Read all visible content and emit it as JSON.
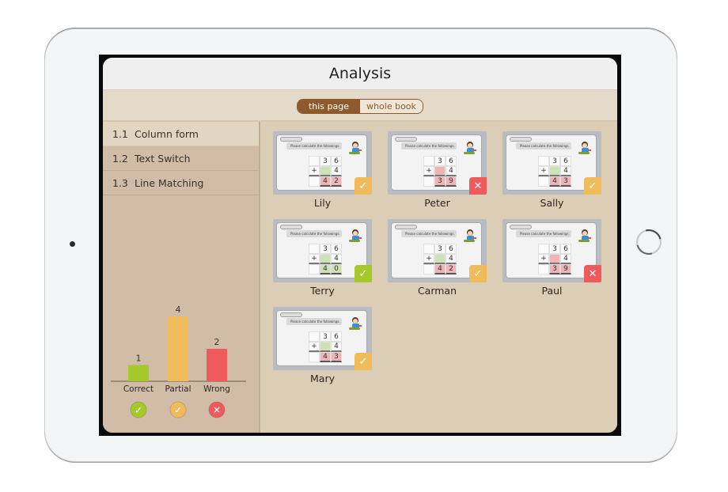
{
  "header": {
    "title": "Analysis"
  },
  "toggle": {
    "options": [
      {
        "label": "this page",
        "active": true
      },
      {
        "label": "whole book",
        "active": false
      }
    ]
  },
  "sidebar": {
    "items": [
      {
        "num": "1.1",
        "label": "Column form",
        "active": true
      },
      {
        "num": "1.2",
        "label": "Text Switch",
        "active": false
      },
      {
        "num": "1.3",
        "label": "Line Matching",
        "active": false
      }
    ]
  },
  "chart_data": {
    "type": "bar",
    "title": "",
    "xlabel": "",
    "ylabel": "",
    "categories": [
      "Correct",
      "Partial",
      "Wrong"
    ],
    "values": [
      1,
      4,
      2
    ],
    "colors": [
      "#a5c92a",
      "#f0bb5b",
      "#ef5a5d"
    ],
    "icons": [
      "check-icon",
      "partial-check-icon",
      "cross-icon"
    ],
    "ylim": [
      0,
      4
    ],
    "grid": false,
    "legend": "none"
  },
  "question": {
    "prompt": "Please calculate the followings.",
    "top": [
      "3",
      "6"
    ],
    "op": "+",
    "second": "4"
  },
  "students": [
    {
      "name": "Lily",
      "answer": [
        "4",
        "2"
      ],
      "status": "partial"
    },
    {
      "name": "Peter",
      "answer": [
        "3",
        "9"
      ],
      "status": "wrong"
    },
    {
      "name": "Sally",
      "answer": [
        "4",
        "3"
      ],
      "status": "partial"
    },
    {
      "name": "Terry",
      "answer": [
        "4",
        "0"
      ],
      "status": "correct"
    },
    {
      "name": "Carman",
      "answer": [
        "4",
        "2"
      ],
      "status": "partial"
    },
    {
      "name": "Paul",
      "answer": [
        "3",
        "9"
      ],
      "status": "wrong"
    },
    {
      "name": "Mary",
      "answer": [
        "4",
        "3"
      ],
      "status": "partial"
    }
  ],
  "status_colors": {
    "correct": "#a5c92a",
    "partial": "#f0bb5b",
    "wrong": "#ef5a5d"
  },
  "status_glyphs": {
    "correct": "✓",
    "partial": "✓̸",
    "wrong": "✕"
  }
}
